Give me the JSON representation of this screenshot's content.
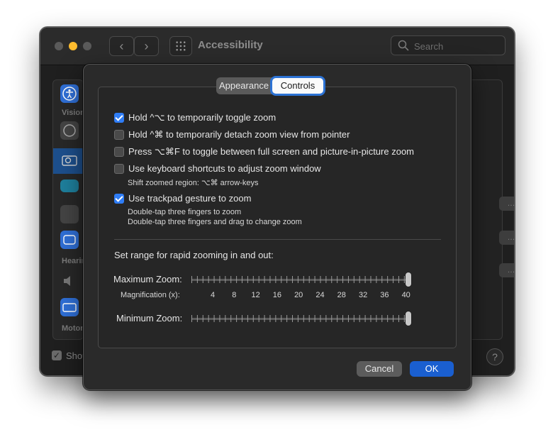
{
  "window": {
    "title": "Accessibility",
    "search_placeholder": "Search",
    "show_label_partial": "Show",
    "help_glyph": "?",
    "ghost_button_text": "…"
  },
  "sidebar": {
    "items": [
      {
        "label": "Vision",
        "icon": "accessibility-icon",
        "color": "#2f6fd6"
      },
      {
        "label": "",
        "icon": "voiceover-icon",
        "color": "#555555"
      },
      {
        "label": "",
        "icon": "zoom-icon",
        "color": "#555555",
        "selected": true
      },
      {
        "label": "",
        "icon": "display-icon",
        "color": "#2a8fb0"
      },
      {
        "label": "",
        "icon": "spoken-content-icon",
        "color": "#555555"
      },
      {
        "label": "Hearing",
        "icon": "captions-icon",
        "color": "#2f6fd6"
      },
      {
        "label": "",
        "icon": "audio-icon",
        "color": "#555555"
      },
      {
        "label": "Motor",
        "icon": "keyboard-icon",
        "color": "#2f6fd6"
      }
    ]
  },
  "sheet": {
    "tabs": [
      {
        "label": "Appearance",
        "selected": false
      },
      {
        "label": "Controls",
        "selected": true
      }
    ],
    "options": [
      {
        "label": "Hold ^⌥ to temporarily toggle zoom",
        "checked": true
      },
      {
        "label": "Hold ^⌘ to temporarily detach zoom view from pointer",
        "checked": false
      },
      {
        "label": "Press ⌥⌘F to toggle between full screen and picture-in-picture zoom",
        "checked": false
      },
      {
        "label": "Use keyboard shortcuts to adjust zoom window",
        "checked": false
      },
      {
        "label": "Use trackpad gesture to zoom",
        "checked": true
      }
    ],
    "notes": {
      "shift_region": "Shift zoomed region:   ⌥⌘ arrow-keys",
      "trackpad_1": "Double-tap three fingers to zoom",
      "trackpad_2": "Double-tap three fingers and drag to change zoom"
    },
    "range_heading": "Set range for rapid zooming in and out:",
    "max_zoom_label": "Maximum Zoom:",
    "min_zoom_label": "Minimum Zoom:",
    "magnification_label": "Magnification (x):",
    "magnification_ticks": [
      "4",
      "8",
      "12",
      "16",
      "20",
      "24",
      "28",
      "32",
      "36",
      "40"
    ],
    "max_zoom_value": 40,
    "min_zoom_value": 40,
    "zoom_range": [
      1,
      40
    ],
    "cancel_label": "Cancel",
    "ok_label": "OK",
    "accent_color": "#2f7df6"
  }
}
